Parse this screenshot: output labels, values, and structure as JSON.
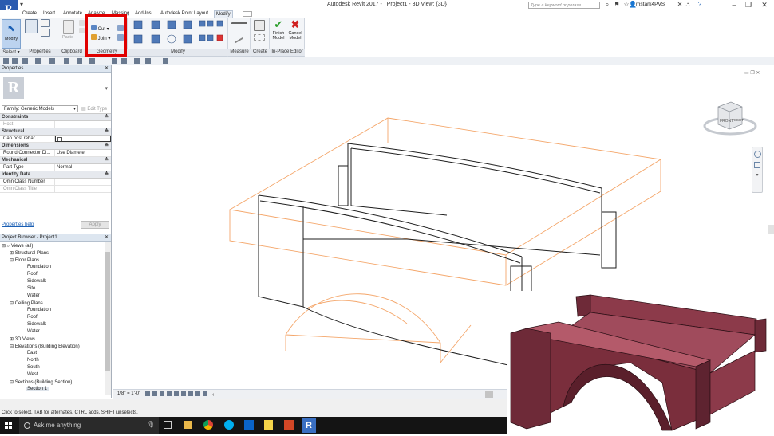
{
  "app_title": "Autodesk Revit 2017 -",
  "doc_title": "Project1 - 3D View: {3D}",
  "search_placeholder": "Type a keyword or phrase",
  "user": "mstark4PVS",
  "tabs": [
    "Create",
    "Insert",
    "Annotate",
    "Analyze",
    "Massing",
    "Add-Ins",
    "Autodesk Point Layout",
    "Modify"
  ],
  "ribbon": {
    "select": {
      "button": "Modify",
      "label": "Select"
    },
    "properties": {
      "label": "Properties"
    },
    "clipboard": {
      "paste": "Paste",
      "label": "Clipboard"
    },
    "geometry": {
      "cut": "Cut",
      "join": "Join",
      "label": "Geometry"
    },
    "modify": {
      "label": "Modify"
    },
    "measure": {
      "label": "Measure"
    },
    "create": {
      "label": "Create"
    },
    "inplace": {
      "finish": "Finish Model",
      "cancel": "Cancel Model",
      "label": "In-Place Editor",
      "finish_l1": "Finish",
      "finish_l2": "Model",
      "cancel_l1": "Cancel",
      "cancel_l2": "Model"
    }
  },
  "properties": {
    "title": "Properties",
    "family_selector": "Family: Generic Models",
    "edit_type": "Edit Type",
    "groups": {
      "constraints": "Constraints",
      "host_label": "Host",
      "structural": "Structural",
      "can_host_rebar": "Can host rebar",
      "dimensions": "Dimensions",
      "round_connector": "Round Connector Di...",
      "round_value": "Use Diameter",
      "mechanical": "Mechanical",
      "part_type": "Part Type",
      "part_value": "Normal",
      "identity": "Identity Data",
      "omniclass_number": "OmniClass Number",
      "omniclass_title": "OmniClass Title"
    },
    "help": "Properties help",
    "apply": "Apply"
  },
  "browser": {
    "title": "Project Browser - Project1",
    "items": {
      "views": "Views (all)",
      "structural_plans": "Structural Plans",
      "floor_plans": "Floor Plans",
      "foundation": "Foundation",
      "roof": "Roof",
      "sidewalk": "Sidewalk",
      "site": "Site",
      "water": "Water",
      "ceiling_plans": "Ceiling Plans",
      "c_foundation": "Foundation",
      "c_roof": "Roof",
      "c_sidewalk": "Sidewalk",
      "c_water": "Water",
      "views_3d": "3D Views",
      "elevations": "Elevations (Building Elevation)",
      "east": "East",
      "north": "North",
      "south": "South",
      "west": "West",
      "sections": "Sections (Building Section)",
      "section1": "Section 1"
    }
  },
  "viewcube": {
    "front": "FRONT",
    "right": "RIGHT"
  },
  "view_scale": "1/8\" = 1'-0\"",
  "status_text": "Click to select, TAB for alternates, CTRL adds, SHIFT unselects.",
  "taskbar": {
    "search": "Ask me anything"
  },
  "colors": {
    "highlight": "#e00000",
    "brick": "#7a2e3c",
    "orange_edge": "#f4a66a"
  }
}
